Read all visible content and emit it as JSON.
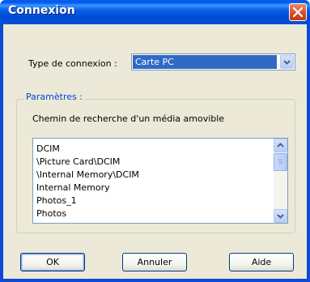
{
  "window": {
    "title": "Connexion"
  },
  "connection": {
    "label": "Type de connexion :",
    "selected": "Carte PC"
  },
  "parameters": {
    "legend": "Paramètres :",
    "search_path_label": "Chemin de recherche d'un média amovible",
    "paths": [
      "DCIM",
      "\\Picture Card\\DCIM",
      "\\Internal Memory\\DCIM",
      "Internal Memory",
      "Photos_1",
      "Photos"
    ]
  },
  "buttons": {
    "ok": "OK",
    "cancel": "Annuler",
    "help": "Aide"
  },
  "colors": {
    "title_bar": "#0a4cd6",
    "selection": "#316ac5",
    "close": "#d64a24",
    "group_legend": "#0046d5"
  }
}
